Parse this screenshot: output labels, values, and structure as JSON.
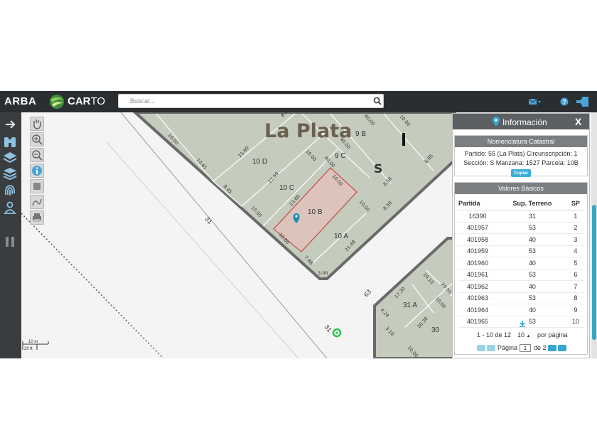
{
  "header": {
    "brand": "ARBA",
    "app_name_a": "CAR",
    "app_name_b": "TO",
    "search_placeholder": "Buscar..."
  },
  "map": {
    "city_label": "La Plata",
    "section_label": "S",
    "parcels": [
      "9 B",
      "9 C",
      "10 D",
      "10 C",
      "10 B",
      "10 A",
      "31 A",
      "30"
    ],
    "streets": [
      "31",
      "63",
      "31"
    ],
    "dimensions": [
      "10.00",
      "10.65",
      "9.45",
      "23.60",
      "23.60",
      "10.00",
      "40.00",
      "10.00",
      "10.00",
      "23.60",
      "10.00",
      "10.00",
      "7.88",
      "3.00",
      "21.48",
      "40.00",
      "40.00",
      "8.50",
      "8.50",
      "8.85",
      "8.85",
      "10.00",
      "17.30",
      "10.10",
      "20.00",
      "20.30",
      "4.24",
      "3.10",
      "10.00",
      "10.00"
    ],
    "scale_m": "10 m",
    "scale_ft": "20 ft"
  },
  "panel": {
    "title": "Información",
    "close": "X",
    "nomenclatura": {
      "title": "Nomenclatura Catastral",
      "line1": "Partido: 55 (La Plata) Circunscripción: 1",
      "line2": "Sección: S Manzana: 1527 Parcela: 10B",
      "copy_label": "Copiar"
    },
    "valores": {
      "title": "Valores Básicos",
      "columns": [
        "Partida",
        "Sup. Terreno",
        "SP"
      ],
      "rows": [
        [
          "16390",
          "31",
          "1"
        ],
        [
          "401957",
          "53",
          "2"
        ],
        [
          "401958",
          "40",
          "3"
        ],
        [
          "401959",
          "53",
          "4"
        ],
        [
          "401960",
          "40",
          "5"
        ],
        [
          "401961",
          "53",
          "6"
        ],
        [
          "401962",
          "40",
          "7"
        ],
        [
          "401963",
          "53",
          "8"
        ],
        [
          "401964",
          "40",
          "9"
        ],
        [
          "401965",
          "53",
          "10"
        ]
      ],
      "range_text": "1 - 10 de 12",
      "page_size": "10",
      "per_page_label": "por página",
      "page_label": "Página",
      "current_page": "1",
      "of_pages": "de 2"
    }
  },
  "colors": {
    "accent": "#36a6d0",
    "topbar": "#2b2e30",
    "parcel_fill": "#c5cbbd",
    "selected_fill": "#dcc3bb",
    "road": "#676767"
  }
}
